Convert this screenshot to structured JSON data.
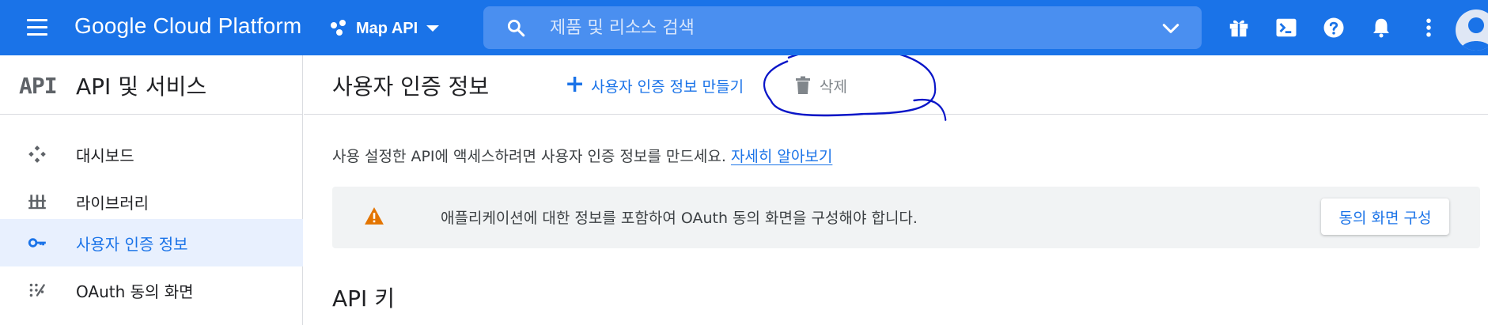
{
  "topbar": {
    "logo": "Google Cloud Platform",
    "project_name": "Map API",
    "search_placeholder": "제품 및 리소스 검색"
  },
  "sidebar": {
    "logo_text": "API",
    "title": "API 및 서비스",
    "items": [
      {
        "label": "대시보드",
        "icon": "dashboard-icon",
        "active": false
      },
      {
        "label": "라이브러리",
        "icon": "library-icon",
        "active": false
      },
      {
        "label": "사용자 인증 정보",
        "icon": "key-icon",
        "active": true
      },
      {
        "label": "OAuth 동의 화면",
        "icon": "oauth-consent-icon",
        "active": false
      }
    ]
  },
  "main": {
    "title": "사용자 인증 정보",
    "create_label": "사용자 인증 정보 만들기",
    "delete_label": "삭제",
    "description": "사용 설정한 API에 액세스하려면 사용자 인증 정보를 만드세요.",
    "learn_more": "자세히 알아보기",
    "banner_text": "애플리케이션에 대한 정보를 포함하여 OAuth 동의 화면을 구성해야 합니다.",
    "consent_button": "동의 화면 구성",
    "section_title": "API 키"
  },
  "colors": {
    "brand_blue": "#1a73e8",
    "warning": "#e37400",
    "annotation_ink": "#0a16c8"
  }
}
